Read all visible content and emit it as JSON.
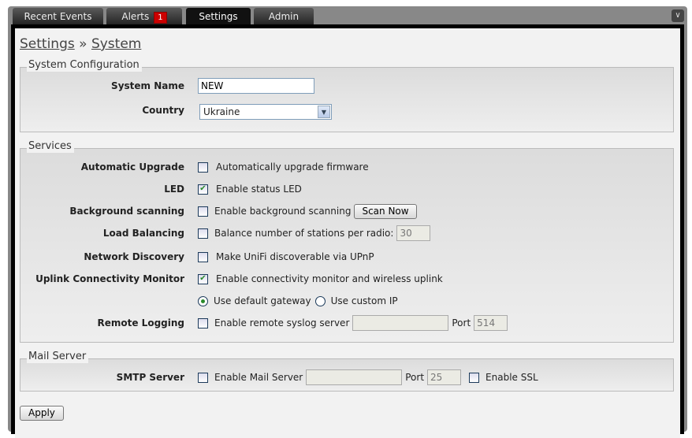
{
  "tabs": [
    {
      "label": "Recent Events"
    },
    {
      "label": "Alerts",
      "badge": "1"
    },
    {
      "label": "Settings",
      "active": true
    },
    {
      "label": "Admin"
    }
  ],
  "breadcrumb": {
    "root": "Settings",
    "sep": "»",
    "current": "System"
  },
  "system_config": {
    "legend": "System Configuration",
    "system_name_label": "System Name",
    "system_name_value": "NEW",
    "country_label": "Country",
    "country_value": "Ukraine"
  },
  "services": {
    "legend": "Services",
    "auto_upgrade": {
      "label": "Automatic Upgrade",
      "text": "Automatically upgrade firmware",
      "checked": false
    },
    "led": {
      "label": "LED",
      "text": "Enable status LED",
      "checked": true
    },
    "bg_scan": {
      "label": "Background scanning",
      "text": "Enable background scanning",
      "button": "Scan Now",
      "checked": false
    },
    "load_balancing": {
      "label": "Load Balancing",
      "text": "Balance number of stations per radio:",
      "value": "30",
      "checked": false
    },
    "network_discovery": {
      "label": "Network Discovery",
      "text": "Make UniFi discoverable via UPnP",
      "checked": false
    },
    "uplink": {
      "label": "Uplink Connectivity Monitor",
      "text": "Enable connectivity monitor and wireless uplink",
      "checked": true,
      "radio_default": "Use default gateway",
      "radio_custom": "Use custom IP"
    },
    "remote_logging": {
      "label": "Remote Logging",
      "text": "Enable remote syslog server",
      "port_label": "Port",
      "port_value": "514",
      "checked": false
    }
  },
  "mail": {
    "legend": "Mail Server",
    "smtp_label": "SMTP Server",
    "text": "Enable Mail Server",
    "port_label": "Port",
    "port_value": "25",
    "ssl_text": "Enable SSL"
  },
  "apply_label": "Apply"
}
